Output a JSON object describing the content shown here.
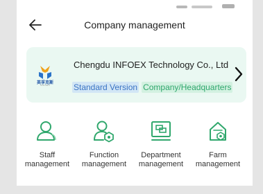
{
  "header": {
    "title": "Company management",
    "back_icon": "arrow-left-icon"
  },
  "company": {
    "name": "Chengdu INFOEX Technology Co., Ltd",
    "version_tag": "Standard Version",
    "type_tag": "Company/Headquarters",
    "logo_text": "英孚克斯",
    "logo_sub": "INFOEX",
    "chevron_icon": "chevron-right-icon"
  },
  "menu": [
    {
      "line1": "Staff",
      "line2": "management",
      "icon": "staff-icon"
    },
    {
      "line1": "Function",
      "line2": "management",
      "icon": "function-icon"
    },
    {
      "line1": "Department",
      "line2": "management",
      "icon": "department-icon"
    },
    {
      "line1": "Farm",
      "line2": "management",
      "icon": "farm-icon"
    }
  ],
  "colors": {
    "accent_green": "#2fa76c",
    "card_bg": "#eaf8f2",
    "tag_blue": "#3a74c4"
  }
}
